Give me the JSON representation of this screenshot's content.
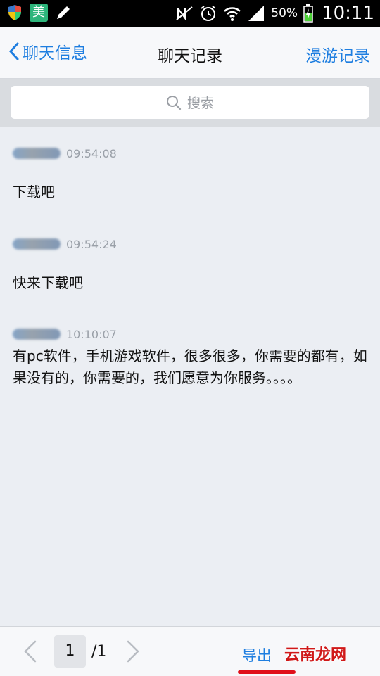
{
  "status_bar": {
    "app_badge": "美",
    "battery": "50%",
    "time": "10:11"
  },
  "nav": {
    "back_label": "聊天信息",
    "title": "聊天记录",
    "right_label": "漫游记录"
  },
  "search": {
    "placeholder": "搜索"
  },
  "messages": [
    {
      "time": "09:54:08",
      "text": "下载吧"
    },
    {
      "time": "09:54:24",
      "text": "快来下载吧"
    },
    {
      "time": "10:10:07",
      "text": "有pc软件，手机游戏软件，很多很多，你需要的都有，如果没有的，你需要的，我们愿意为你服务。。。。"
    }
  ],
  "pager": {
    "current": "1",
    "total": "/1"
  },
  "export_label": "导出",
  "watermark": "云南龙网",
  "colors": {
    "accent": "#1e7ee0",
    "underline": "#e0101a"
  }
}
